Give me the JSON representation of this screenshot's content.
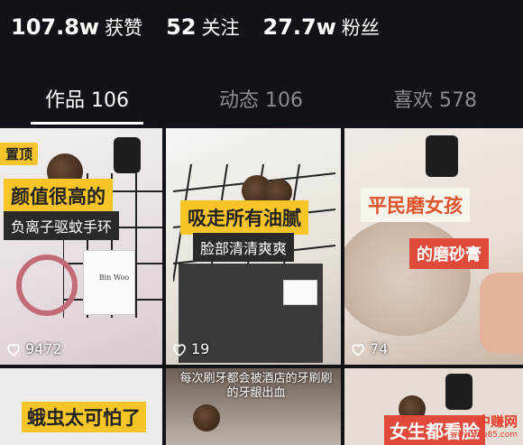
{
  "profile_stats": [
    {
      "value": "107.8w",
      "label": "获赞"
    },
    {
      "value": "52",
      "label": "关注"
    },
    {
      "value": "27.7w",
      "label": "粉丝"
    }
  ],
  "tabs": [
    {
      "label": "作品 106",
      "active": true
    },
    {
      "label": "动态 106",
      "active": false
    },
    {
      "label": "喜欢 578",
      "active": false
    }
  ],
  "posts": [
    {
      "pinned_label": "置顶",
      "headline": "颜值很高的",
      "subtitle": "负离子驱蚊手环",
      "box_text": "Bin Woo",
      "likes": "9472"
    },
    {
      "headline": "吸走所有油腻",
      "subtitle": "脸部清清爽爽",
      "likes": "19"
    },
    {
      "headline": "平民磨女孩",
      "subtitle": "的磨砂膏",
      "likes": "74"
    },
    {
      "headline": "蛾虫太可怕了"
    },
    {
      "caption": "每次刷牙都会被酒店的牙刷刷的牙龈出血"
    },
    {
      "headline": "女生都看脸"
    }
  ],
  "watermark": {
    "name": "中赚网",
    "url": "www.you85.com"
  },
  "colors": {
    "background": "#111318",
    "accent_yellow": "#f7c528",
    "accent_red": "#e04a3a",
    "tab_inactive": "#8a8c92"
  }
}
